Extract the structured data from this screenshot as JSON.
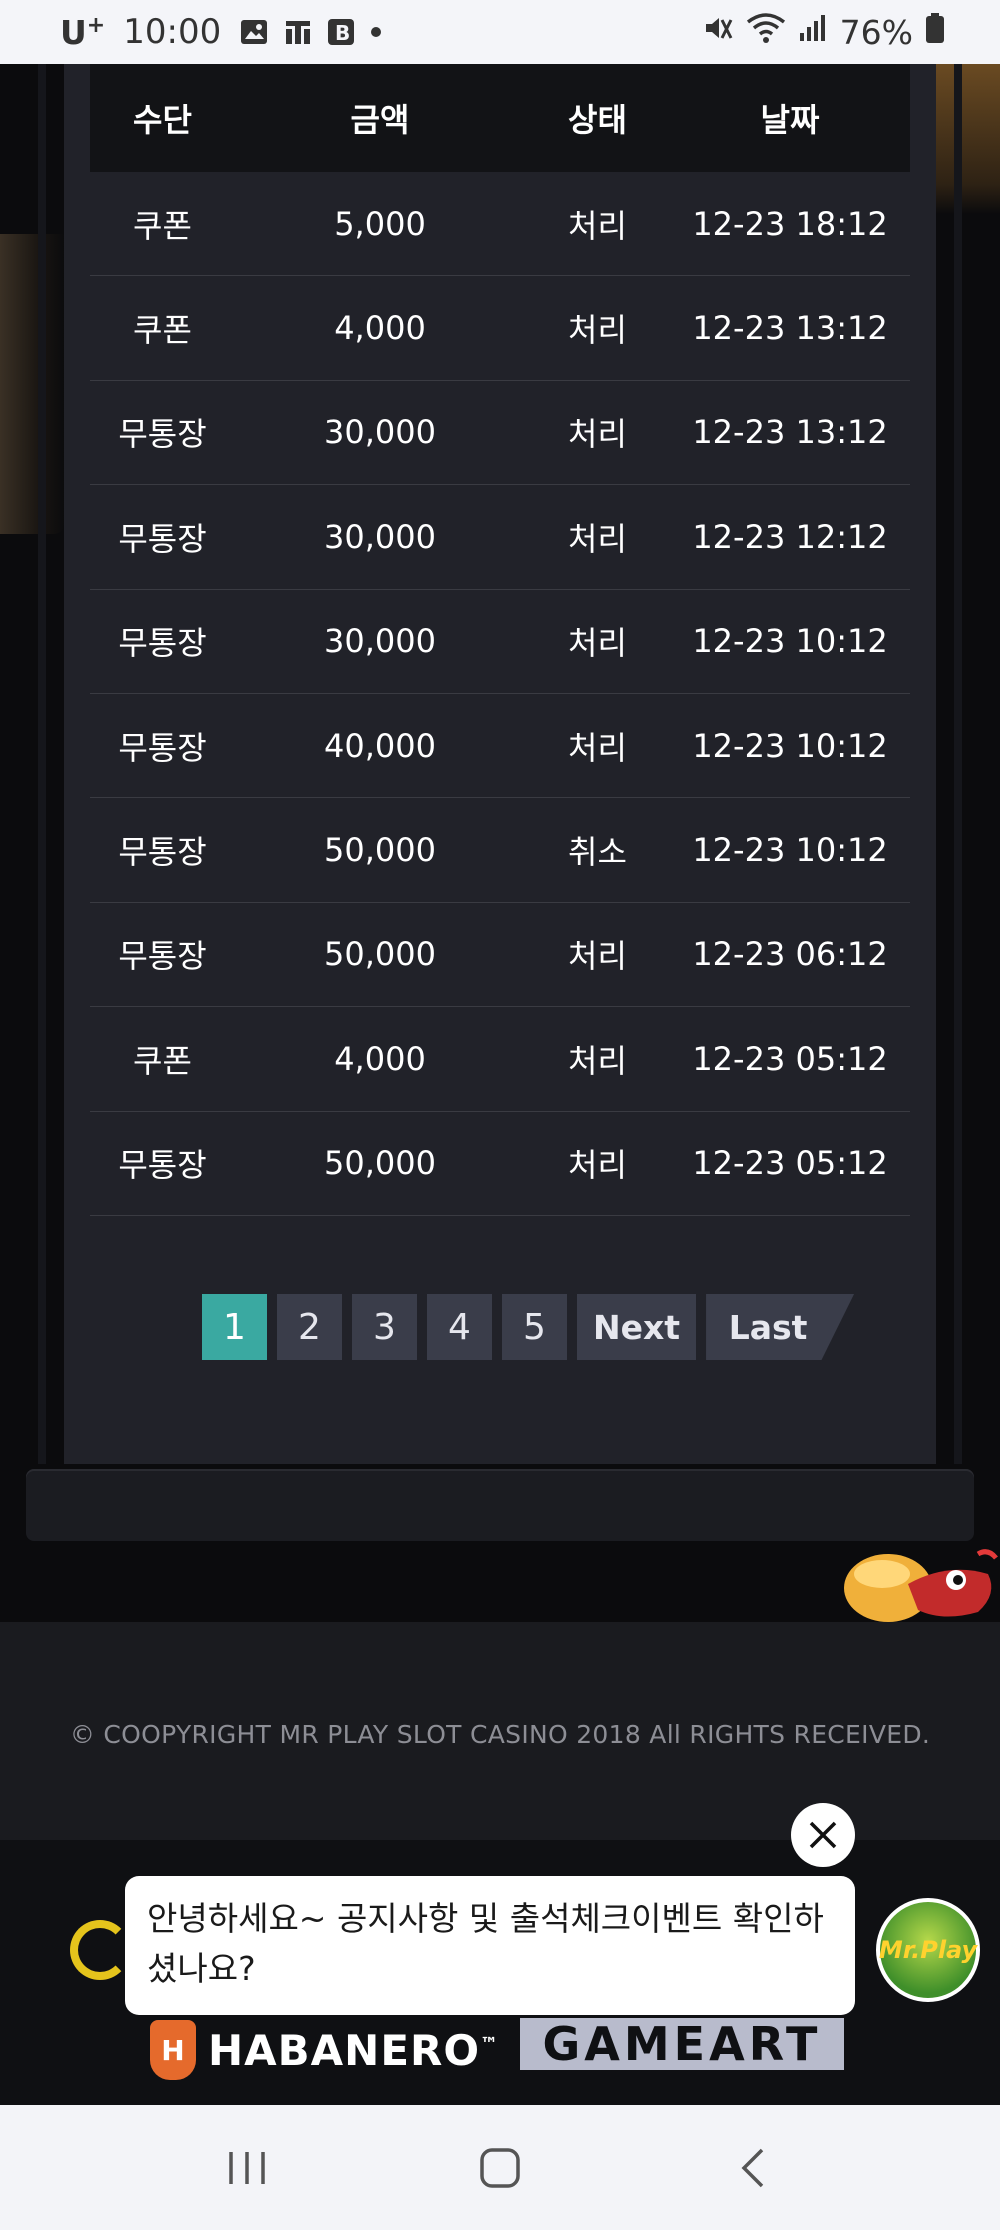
{
  "status_bar": {
    "carrier": "U",
    "carrier_sup": "+",
    "time": "10:00",
    "battery": "76%"
  },
  "table": {
    "headers": [
      "수단",
      "금액",
      "상태",
      "날짜"
    ],
    "rows": [
      {
        "method": "쿠폰",
        "amount": "5,000",
        "status": "처리",
        "date": "12-23 18:12"
      },
      {
        "method": "쿠폰",
        "amount": "4,000",
        "status": "처리",
        "date": "12-23 13:12"
      },
      {
        "method": "무통장",
        "amount": "30,000",
        "status": "처리",
        "date": "12-23 13:12"
      },
      {
        "method": "무통장",
        "amount": "30,000",
        "status": "처리",
        "date": "12-23 12:12"
      },
      {
        "method": "무통장",
        "amount": "30,000",
        "status": "처리",
        "date": "12-23 10:12"
      },
      {
        "method": "무통장",
        "amount": "40,000",
        "status": "처리",
        "date": "12-23 10:12"
      },
      {
        "method": "무통장",
        "amount": "50,000",
        "status": "취소",
        "date": "12-23 10:12"
      },
      {
        "method": "무통장",
        "amount": "50,000",
        "status": "처리",
        "date": "12-23 06:12"
      },
      {
        "method": "쿠폰",
        "amount": "4,000",
        "status": "처리",
        "date": "12-23 05:12"
      },
      {
        "method": "무통장",
        "amount": "50,000",
        "status": "처리",
        "date": "12-23 05:12"
      }
    ]
  },
  "pagination": {
    "pages": [
      "1",
      "2",
      "3",
      "4",
      "5"
    ],
    "current": "1",
    "next": "Next",
    "last": "Last"
  },
  "footer": {
    "copyright": "© COOPYRIGHT MR PLAY SLOT CASINO 2018 All RIGHTS RECEIVED."
  },
  "providers": {
    "habanero": "HABANERO",
    "habanero_tm": "™",
    "gameart": "GAMEART"
  },
  "chat": {
    "message": "안녕하세요~ 공지사항 및 출석체크이벤트 확인하셨나요?",
    "avatar_label": "Mr.Play"
  },
  "colors": {
    "accent": "#3aa9a1",
    "panel": "#212229",
    "header": "#121316"
  },
  "icons": [
    "gallery-icon",
    "t-app-icon",
    "b-app-icon",
    "mute-icon",
    "wifi-icon",
    "signal-icon",
    "battery-icon",
    "close-icon",
    "recents-icon",
    "home-icon",
    "back-icon"
  ]
}
